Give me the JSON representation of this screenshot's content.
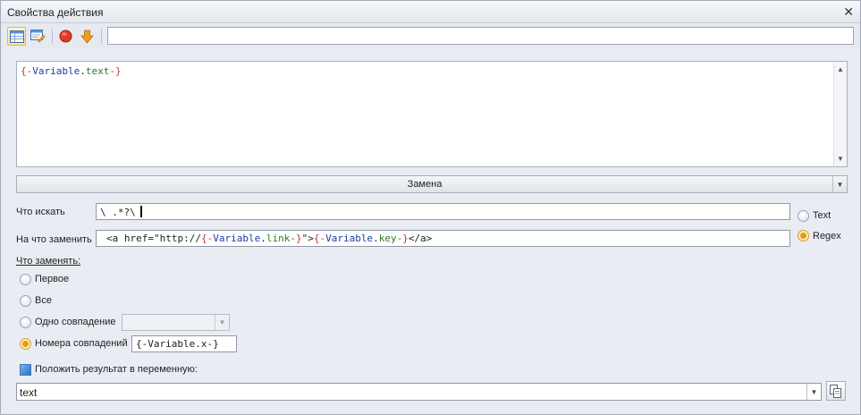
{
  "window": {
    "title": "Свойства действия",
    "close_glyph": "✕"
  },
  "toolbar": {
    "buttons": [
      {
        "icon": "table-view-icon",
        "active": true
      },
      {
        "icon": "edit-properties-icon",
        "active": false
      },
      {
        "icon": "stop-red-icon",
        "active": false
      },
      {
        "icon": "arrow-down-orange-icon",
        "active": false
      }
    ],
    "input_value": ""
  },
  "editor": {
    "tokens": [
      {
        "text": "{-",
        "role": "brace"
      },
      {
        "text": "Variable",
        "role": "var"
      },
      {
        "text": ".",
        "role": "dot"
      },
      {
        "text": "text",
        "role": "prop"
      },
      {
        "text": "-}",
        "role": "brace"
      }
    ]
  },
  "mode": {
    "label": "Замена"
  },
  "search": {
    "label": "Что искать",
    "value": "\\ .*?\\"
  },
  "replace": {
    "label": "На что заменить",
    "tokens": [
      {
        "text": "<a href=\"http://",
        "role": "dot"
      },
      {
        "text": "{-",
        "role": "brace"
      },
      {
        "text": "Variable",
        "role": "var"
      },
      {
        "text": ".",
        "role": "dot"
      },
      {
        "text": "link",
        "role": "prop"
      },
      {
        "text": "-}",
        "role": "brace"
      },
      {
        "text": "\">",
        "role": "dot"
      },
      {
        "text": "{-",
        "role": "brace"
      },
      {
        "text": "Variable",
        "role": "var"
      },
      {
        "text": ".",
        "role": "dot"
      },
      {
        "text": "key",
        "role": "prop"
      },
      {
        "text": "-}",
        "role": "brace"
      },
      {
        "text": "</a>",
        "role": "dot"
      }
    ]
  },
  "match_type": {
    "options": [
      {
        "label": "Text",
        "checked": false
      },
      {
        "label": "Regex",
        "checked": true
      }
    ]
  },
  "replace_what": {
    "title": "Что заменять:",
    "options": [
      {
        "label": "Первое",
        "checked": false
      },
      {
        "label": "Все",
        "checked": false
      },
      {
        "label": "Одно совпадение",
        "checked": false,
        "combo_value": ""
      },
      {
        "label": "Номера совпадений",
        "checked": true,
        "input_value": "{-Variable.x-}"
      }
    ]
  },
  "result": {
    "checkbox_label": "Положить результат в переменную:",
    "checked": true,
    "variable": "text"
  },
  "colors": {
    "brace": "#c0392b",
    "var": "#1a3ea8",
    "prop": "#2a7a2a",
    "radio_checked": "#e59a16",
    "background": "#e9edf3"
  }
}
